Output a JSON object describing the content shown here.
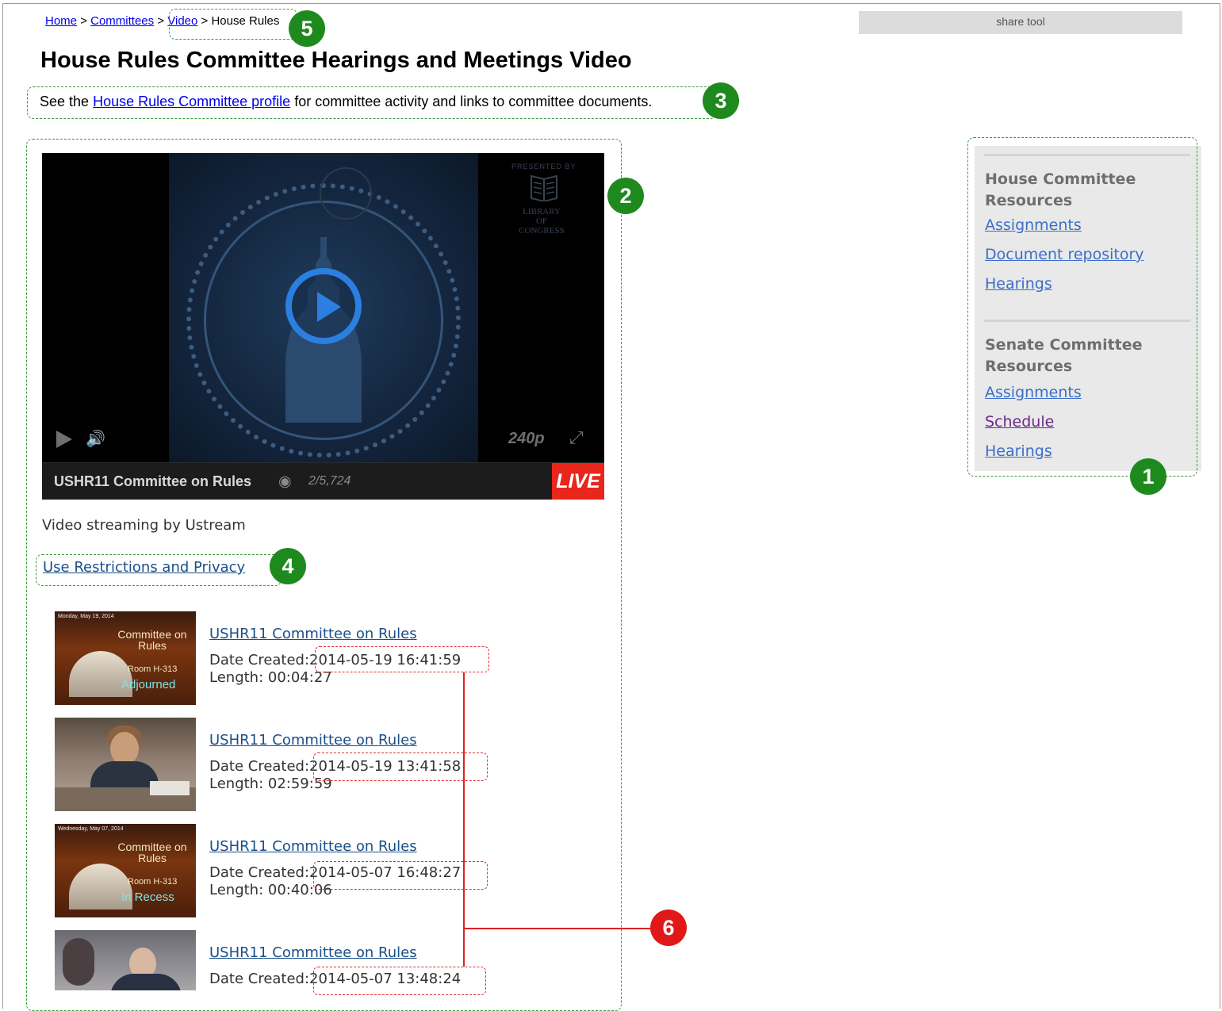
{
  "breadcrumb": {
    "home": "Home",
    "committees": "Committees",
    "video": "Video",
    "current": "House Rules",
    "separator": ">"
  },
  "share_tool": "share tool",
  "page_title": "House Rules Committee Hearings and Meetings Video",
  "intro": {
    "prefix": "See the",
    "link": "House Rules Committee profile",
    "suffix": "for committee activity and links to committee documents."
  },
  "player": {
    "presented_by": "PRESENTED BY",
    "library_name": "LIBRARY OF CONGRESS",
    "quality": "240p",
    "channel_name": "USHR11 Committee on Rules",
    "viewers": "2/5,724",
    "live_label": "LIVE",
    "play_icon": "play-icon",
    "volume_icon": "volume-icon",
    "fullscreen_icon": "fullscreen-icon",
    "eye_icon": "eye-icon"
  },
  "streaming_note": "Video streaming by Ustream",
  "restrictions_link": "Use Restrictions and Privacy",
  "videos": [
    {
      "title": "USHR11 Committee on Rules",
      "date_label": "Date Created:",
      "date": "2014-05-19 16:41:59",
      "length_label": "Length:",
      "length": "00:04:27",
      "thumb_date": "Monday, May 19, 2014",
      "thumb_title": "Committee on Rules",
      "thumb_room": "Room H-313",
      "thumb_status": "Adjourned"
    },
    {
      "title": "USHR11 Committee on Rules",
      "date_label": "Date Created:",
      "date": "2014-05-19 13:41:58",
      "length_label": "Length:",
      "length": "02:59:59"
    },
    {
      "title": "USHR11 Committee on Rules",
      "date_label": "Date Created:",
      "date": "2014-05-07 16:48:27",
      "length_label": "Length:",
      "length": "00:40:06",
      "thumb_date": "Wednesday, May 07, 2014",
      "thumb_title": "Committee on Rules",
      "thumb_room": "Room H-313",
      "thumb_status": "In Recess"
    },
    {
      "title": "USHR11 Committee on Rules",
      "date_label": "Date Created:",
      "date": "2014-05-07 13:48:24"
    }
  ],
  "sidebar": {
    "house_heading": "House Committee Resources",
    "house_links": [
      "Assignments",
      "Document repository",
      "Hearings"
    ],
    "senate_heading": "Senate Committee Resources",
    "senate_links": [
      "Assignments",
      "Schedule",
      "Hearings"
    ]
  },
  "annotations": {
    "badge_1": "1",
    "badge_2": "2",
    "badge_3": "3",
    "badge_4": "4",
    "badge_5": "5",
    "badge_6": "6",
    "green_color": "#1e8a1e",
    "red_color": "#e01818"
  }
}
